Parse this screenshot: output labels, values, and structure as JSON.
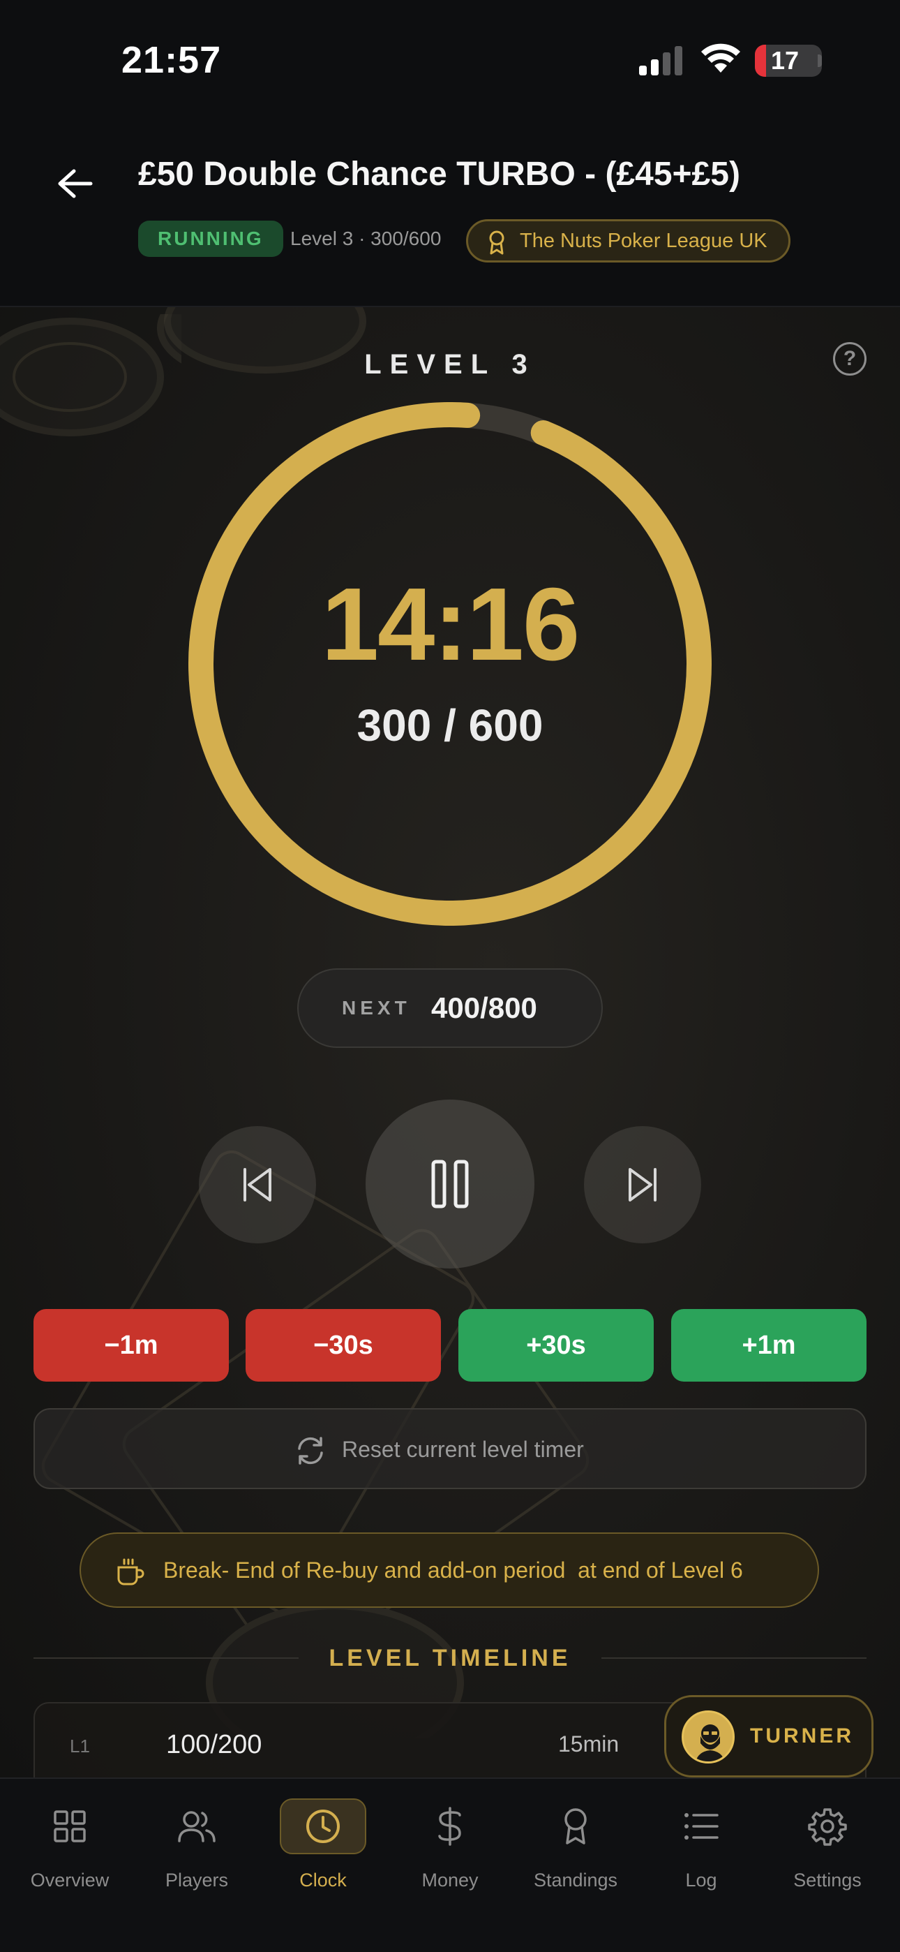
{
  "status_bar": {
    "time": "21:57",
    "battery": "17",
    "battery_level": 0.17
  },
  "header": {
    "title": "£50 Double Chance TURBO - (£45+£5)",
    "status_badge": "RUNNING",
    "level_meta": "Level 3 · 300/600",
    "league": "The Nuts Poker League UK"
  },
  "clock": {
    "level_label": "LEVEL 3",
    "help": "?",
    "time_remaining": "14:16",
    "blinds": "300 / 600",
    "progress_remaining": 0.95,
    "next_label": "NEXT",
    "next_value": "400/800"
  },
  "adjust": {
    "minus_1m": "−1m",
    "minus_30s": "−30s",
    "plus_30s": "+30s",
    "plus_1m": "+1m"
  },
  "reset_label": "Reset current level timer",
  "break_text": "Break- End of Re-buy and add-on period  at end of Level 6",
  "timeline": {
    "title": "LEVEL TIMELINE",
    "rows": [
      {
        "level": "L1",
        "blinds": "100/200",
        "duration": "15min"
      }
    ]
  },
  "turner": {
    "name": "TURNER"
  },
  "tabs": [
    {
      "label": "Overview",
      "icon": "grid-icon"
    },
    {
      "label": "Players",
      "icon": "users-icon"
    },
    {
      "label": "Clock",
      "icon": "clock-icon",
      "active": true
    },
    {
      "label": "Money",
      "icon": "dollar-icon"
    },
    {
      "label": "Standings",
      "icon": "award-icon"
    },
    {
      "label": "Log",
      "icon": "list-icon"
    },
    {
      "label": "Settings",
      "icon": "gear-icon"
    }
  ],
  "colors": {
    "accent": "#d4af4f",
    "danger": "#c8342b",
    "success": "#2ba35a",
    "running": "#4fbf72"
  }
}
